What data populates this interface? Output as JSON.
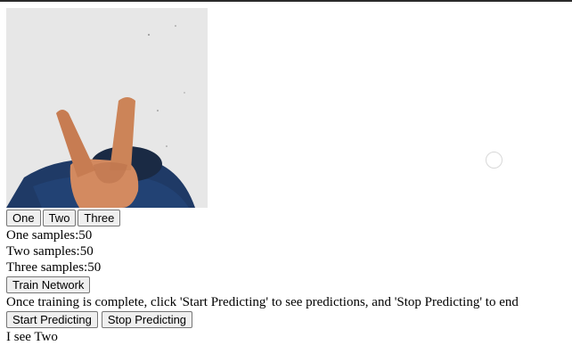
{
  "class_buttons": {
    "one": "One",
    "two": "Two",
    "three": "Three"
  },
  "samples": {
    "one_label": "One samples:",
    "one_count": "50",
    "two_label": "Two samples:",
    "two_count": "50",
    "three_label": "Three samples:",
    "three_count": "50"
  },
  "train_button": "Train Network",
  "instructions": "Once training is complete, click 'Start Predicting' to see predictions, and 'Stop Predicting' to end",
  "predict_buttons": {
    "start": "Start Predicting",
    "stop": "Stop Predicting"
  },
  "prediction": "I see Two"
}
